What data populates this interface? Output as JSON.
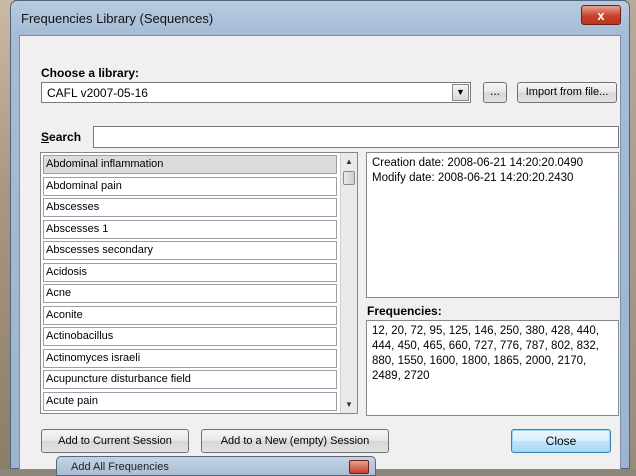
{
  "window": {
    "title": "Frequencies Library (Sequences)",
    "close_glyph": "x"
  },
  "library": {
    "label": "Choose a library:",
    "selected": "CAFL v2007-05-16",
    "browse_label": "...",
    "import_label": "Import from file..."
  },
  "search": {
    "label_hotkey": "S",
    "label_rest": "earch",
    "value": ""
  },
  "list": {
    "items": [
      "Abdominal inflammation",
      "Abdominal pain",
      "Abscesses",
      "Abscesses 1",
      "Abscesses secondary",
      "Acidosis",
      "Acne",
      "Aconite",
      "Actinobacillus",
      "Actinomyces israeli",
      "Acupuncture disturbance field",
      "Acute pain"
    ],
    "selected_index": 0
  },
  "details": {
    "creation": "Creation date: 2008-06-21 14:20:20.0490",
    "modify": "Modify date: 2008-06-21 14:20:20.2430"
  },
  "frequencies": {
    "label": "Frequencies:",
    "text": "12, 20, 72, 95, 125, 146, 250, 380, 428, 440, 444, 450, 465, 660, 727, 776, 787, 802, 832, 880, 1550, 1600, 1800, 1865, 2000, 2170, 2489, 2720"
  },
  "buttons": {
    "add_current": "Add to Current Session",
    "add_new": "Add to a New (empty) Session",
    "close": "Close"
  },
  "sub_window": {
    "title": "Add All Frequencies"
  },
  "icons": {
    "combo_arrow": "chevron-down-icon",
    "scroll_up": "scroll-up-icon",
    "scroll_down": "scroll-down-icon",
    "close": "close-icon"
  }
}
